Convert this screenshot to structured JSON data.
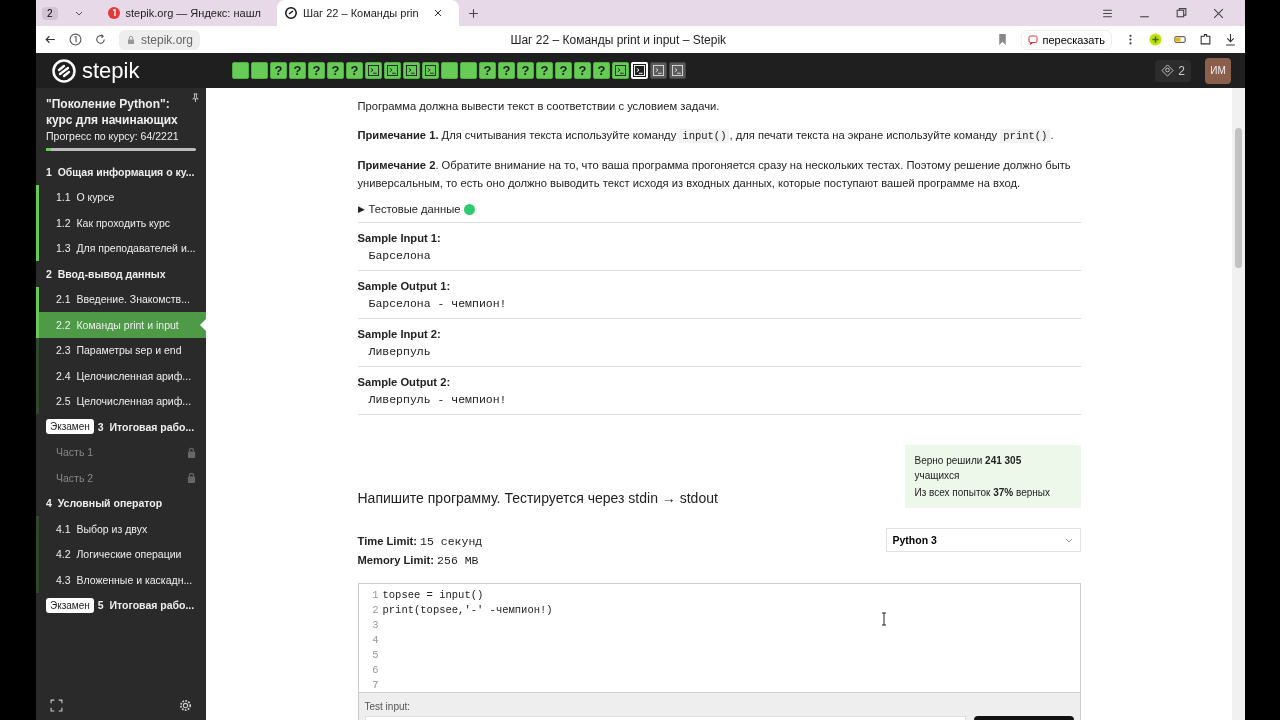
{
  "browser": {
    "tab_count": "2",
    "tabs": [
      {
        "title": "stepik.org — Яндекс: нашл",
        "selected": false
      },
      {
        "title": "Шаг 22 – Команды prin",
        "selected": true
      }
    ],
    "address": "stepik.org",
    "page_title": "Шаг 22 – Команды print и input – Stepik",
    "retell": "пересказать"
  },
  "header": {
    "logo": "stepik",
    "steps": [
      {
        "kind": "theory",
        "passed": true,
        "selected": false
      },
      {
        "kind": "theory",
        "passed": true,
        "selected": false
      },
      {
        "kind": "quiz",
        "symbol": "?",
        "passed": true,
        "selected": false
      },
      {
        "kind": "quiz",
        "symbol": "?",
        "passed": true,
        "selected": false
      },
      {
        "kind": "quiz",
        "symbol": "?",
        "passed": true,
        "selected": false
      },
      {
        "kind": "quiz",
        "symbol": "?",
        "passed": true,
        "selected": false
      },
      {
        "kind": "quiz",
        "symbol": "?",
        "passed": true,
        "selected": false
      },
      {
        "kind": "code",
        "passed": true,
        "selected": false
      },
      {
        "kind": "code",
        "passed": true,
        "selected": false
      },
      {
        "kind": "code",
        "passed": true,
        "selected": false
      },
      {
        "kind": "code",
        "passed": true,
        "selected": false
      },
      {
        "kind": "theory",
        "passed": true,
        "selected": false
      },
      {
        "kind": "theory",
        "passed": true,
        "selected": false
      },
      {
        "kind": "quiz",
        "symbol": "?",
        "passed": true,
        "selected": false
      },
      {
        "kind": "quiz",
        "symbol": "?",
        "passed": true,
        "selected": false
      },
      {
        "kind": "quiz",
        "symbol": "?",
        "passed": true,
        "selected": false
      },
      {
        "kind": "quiz",
        "symbol": "?",
        "passed": true,
        "selected": false
      },
      {
        "kind": "quiz",
        "symbol": "?",
        "passed": true,
        "selected": false
      },
      {
        "kind": "quiz",
        "symbol": "?",
        "passed": true,
        "selected": false
      },
      {
        "kind": "quiz",
        "symbol": "?",
        "passed": true,
        "selected": false
      },
      {
        "kind": "code",
        "passed": true,
        "selected": false
      },
      {
        "kind": "code",
        "passed": false,
        "selected": true
      },
      {
        "kind": "code",
        "passed": false,
        "selected": false
      },
      {
        "kind": "code",
        "passed": false,
        "selected": false
      }
    ],
    "points": "2",
    "avatar": "ИМ"
  },
  "sidebar": {
    "course_title": "\"Поколение Python\": курс для начинающих",
    "progress_label": "Прогресс по курсу:  64/2221",
    "progress": {
      "level": 0.03
    },
    "modules": [
      {
        "number": "1",
        "title": "Общая информация о ку...",
        "lessons": [
          {
            "number": "1.1",
            "title": "О курсе",
            "passed": true,
            "selected": false,
            "locked": false
          },
          {
            "number": "1.2",
            "title": "Как проходить курс",
            "passed": true,
            "selected": false,
            "locked": false
          },
          {
            "number": "1.3",
            "title": "Для преподавателей и...",
            "passed": true,
            "selected": false,
            "locked": false
          }
        ]
      },
      {
        "number": "2",
        "title": "Ввод-вывод данных",
        "lessons": [
          {
            "number": "2.1",
            "title": "Введение. Знакомств...",
            "passed": true,
            "selected": false,
            "locked": false
          },
          {
            "number": "2.2",
            "title": "Команды print и input",
            "passed": true,
            "selected": true,
            "locked": false
          },
          {
            "number": "2.3",
            "title": "Параметры sep и end",
            "passed": false,
            "selected": false,
            "locked": false
          },
          {
            "number": "2.4",
            "title": "Целочисленная ариф...",
            "passed": false,
            "selected": false,
            "locked": false
          },
          {
            "number": "2.5",
            "title": "Целочисленная ариф...",
            "passed": false,
            "selected": false,
            "locked": false
          }
        ]
      },
      {
        "number": "3",
        "title": "Итоговая рабо...",
        "badge": "Экзамен",
        "lessons": [
          {
            "title": "Часть 1",
            "selected": false,
            "locked": true
          },
          {
            "title": "Часть 2",
            "selected": false,
            "locked": true
          }
        ]
      },
      {
        "number": "4",
        "title": "Условный оператор",
        "lessons": [
          {
            "number": "4.1",
            "title": "Выбор из двух",
            "passed": false,
            "selected": false,
            "locked": false
          },
          {
            "number": "4.2",
            "title": "Логические операции",
            "passed": false,
            "selected": false,
            "locked": false
          },
          {
            "number": "4.3",
            "title": "Вложенные и каскадн...",
            "passed": false,
            "selected": false,
            "locked": false
          }
        ]
      },
      {
        "number": "5",
        "title": "Итоговая рабо...",
        "badge": "Экзамен"
      }
    ]
  },
  "content": {
    "paragraphs": [
      [
        {
          "kind": "text",
          "text": "Программа должна вывести текст в соответствии с условием задачи."
        }
      ],
      [
        {
          "kind": "text",
          "text": "**Примечание 1.** Для считывания текста используйте команду "
        },
        {
          "kind": "code",
          "text": "input()"
        },
        {
          "kind": "text",
          "text": ", для печати текста на экране используйте команду "
        },
        {
          "kind": "code",
          "text": "print()"
        },
        {
          "kind": "text",
          "text": "."
        }
      ],
      [
        {
          "kind": "text",
          "text": "**Примечание 2**. Обратите внимание на то, что ваша программа прогоняется сразу на нескольких тестах. Поэтому решение должно быть универсальным, то есть оно должно выводить текст исходя из входных данных, которые поступают вашей программе на вход."
        }
      ]
    ],
    "test_data": {
      "marker": "▶",
      "label": "Тестовые данные",
      "expanded": false,
      "color": "#2ecc71"
    },
    "samples": [
      {
        "label": "Sample Input 1:",
        "value": "Барселона"
      },
      {
        "label": "Sample Output 1:",
        "value": "Барселона - чемпион!"
      },
      {
        "label": "Sample Input 2:",
        "value": "Ливерпуль"
      },
      {
        "label": "Sample Output 2:",
        "value": "Ливерпуль - чемпион!"
      }
    ],
    "stats": [
      "Верно решили **241 305** учащихся",
      "Из всех попыток **37%** верных"
    ],
    "task_title": "Напишите программу. Тестируется через stdin → stdout",
    "limits": [
      {
        "label": "Time Limit:",
        "value": "15 секунд"
      },
      {
        "label": "Memory Limit:",
        "value": "256 MB"
      }
    ],
    "language": "Python 3",
    "code_lines": [
      {
        "number": "1",
        "code": "topsee = input()"
      },
      {
        "number": "2",
        "code": "print(topsee,'-' -чемпион!)"
      },
      {
        "number": "3"
      },
      {
        "number": "4"
      },
      {
        "number": "5"
      },
      {
        "number": "6"
      },
      {
        "number": "7"
      }
    ],
    "test_input_label": "Test input:"
  }
}
